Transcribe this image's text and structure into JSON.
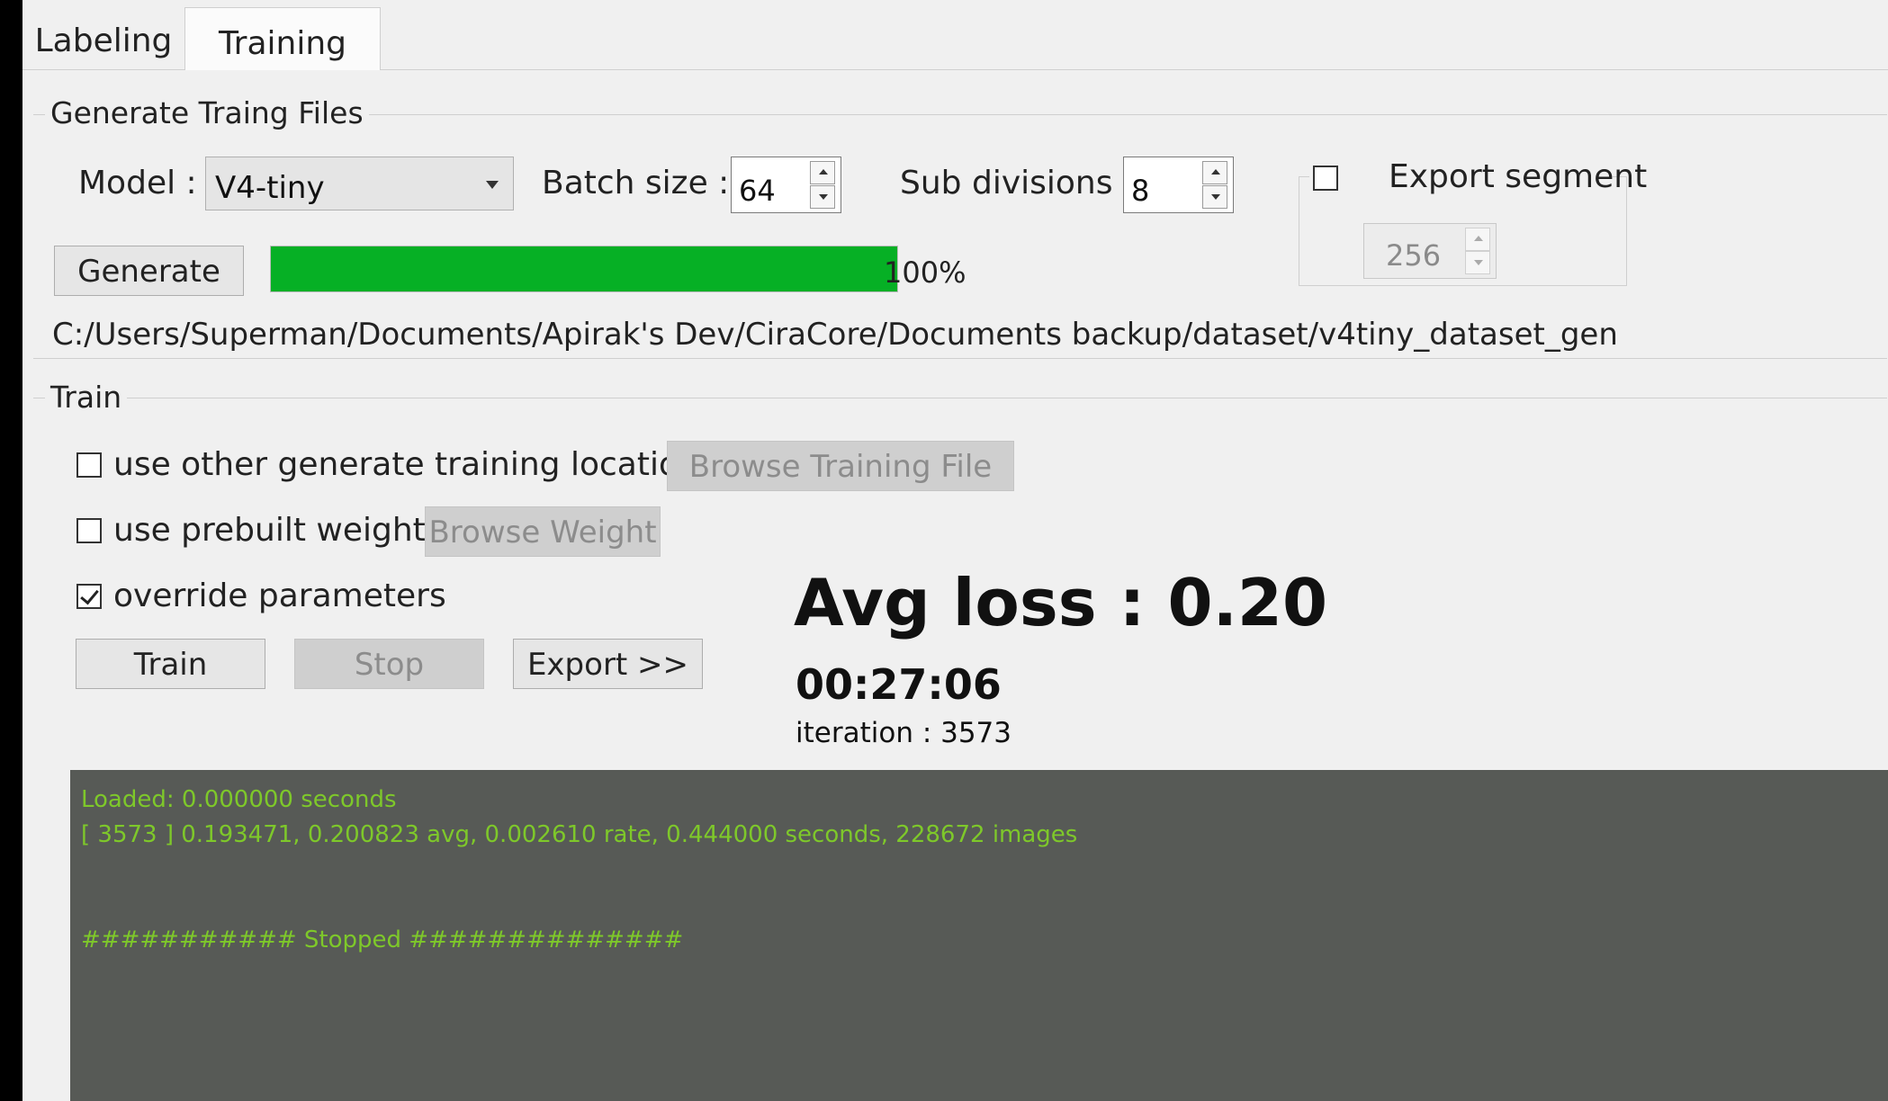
{
  "tabs": [
    {
      "label": "Labeling",
      "active": false
    },
    {
      "label": "Training",
      "active": true
    }
  ],
  "generate": {
    "title": "Generate Traing Files",
    "model_label": "Model :",
    "model_value": "V4-tiny",
    "batch_label": "Batch size :",
    "batch_value": "64",
    "subdiv_label": "Sub divisions :",
    "subdiv_value": "8",
    "export_segment_label": "Export segment",
    "export_segment_checked": false,
    "segment_value": "256",
    "generate_button": "Generate",
    "progress_percent": 100,
    "progress_text": "100%",
    "output_path": "C:/Users/Superman/Documents/Apirak's Dev/CiraCore/Documents backup/dataset/v4tiny_dataset_gen"
  },
  "train": {
    "title": "Train",
    "other_location_label": "use other generate training location",
    "other_location_checked": false,
    "browse_training_button": "Browse Training File",
    "prebuilt_label": "use prebuilt weight",
    "prebuilt_checked": false,
    "browse_weight_button": "Browse Weight",
    "override_label": "override parameters",
    "override_checked": true,
    "train_button": "Train",
    "stop_button": "Stop",
    "export_button": "Export >>",
    "avg_loss": "Avg loss : 0.20",
    "elapsed": "00:27:06",
    "iteration": "iteration : 3573"
  },
  "console": {
    "lines": [
      "Loaded: 0.000000 seconds",
      "[ 3573 ] 0.193471, 0.200823 avg, 0.002610 rate, 0.444000 seconds, 228672 images",
      "",
      "",
      "########### Stopped ##############"
    ]
  },
  "colors": {
    "progress_fill": "#06b025",
    "console_bg": "#575a56",
    "console_text": "#7ec82a"
  }
}
